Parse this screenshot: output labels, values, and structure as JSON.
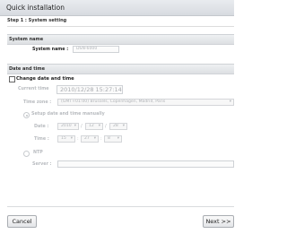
{
  "window": {
    "title": "Quick installation"
  },
  "step": {
    "label": "Step 1 : System setting"
  },
  "system_name": {
    "header": "System name",
    "label": "System name :",
    "value": "DSN-6000"
  },
  "date_time": {
    "header": "Date and time",
    "change_label": "Change date and time",
    "current_time_label": "Current time",
    "current_time_value": "2010/12/28 15:27:14",
    "time_zone_label": "Time zone :",
    "time_zone_value": "(GMT+01:00) Brussels, Copenhagen, Madrid, Paris",
    "manual_label": "Setup date and time manually",
    "date_label": "Date :",
    "date_year": "2010",
    "date_month": "12",
    "date_day": "28",
    "date_sep": "/",
    "time_label": "Time :",
    "time_hour": "15",
    "time_minute": "27",
    "time_second": "8",
    "time_sep": ":",
    "ntp_label": "NTP",
    "server_label": "Server :",
    "server_value": ""
  },
  "footer": {
    "cancel_label": "Cancel",
    "next_label": "Next >>"
  },
  "icons": {
    "dropdown": "chevron-down-icon"
  }
}
